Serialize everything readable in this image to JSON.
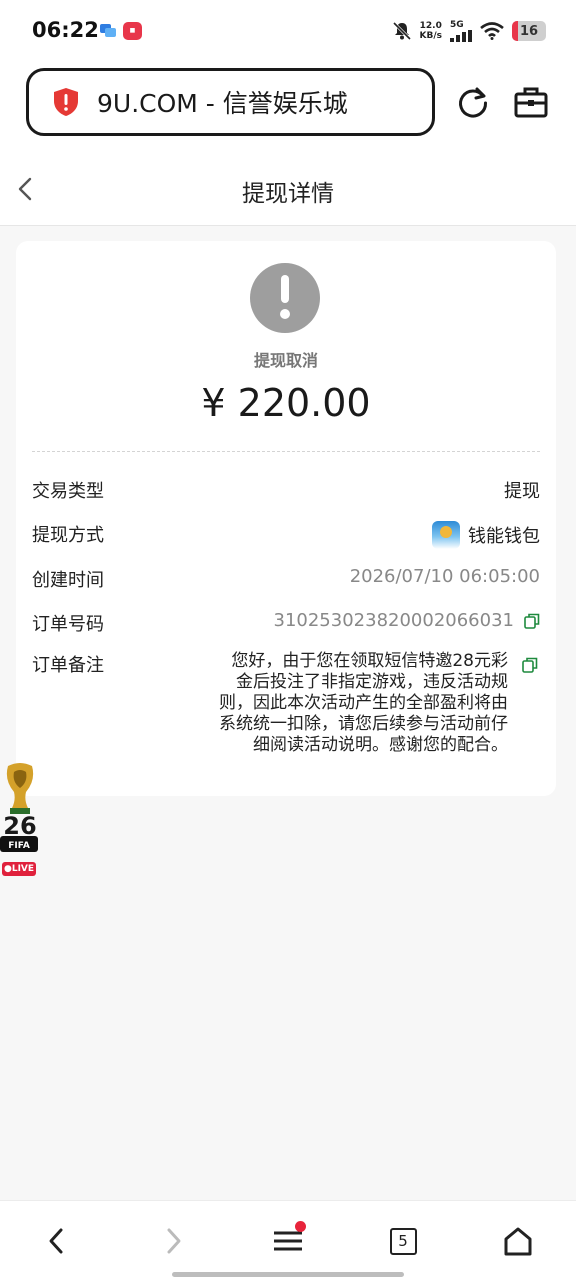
{
  "status_bar": {
    "time": "06:22",
    "speed_top": "12.0",
    "speed_unit": "KB/s",
    "network": "5G",
    "battery": "16"
  },
  "browser": {
    "url": "9U.COM - 信誉娱乐城"
  },
  "header": {
    "title": "提现详情"
  },
  "withdrawal": {
    "status": "提现取消",
    "amount": "¥ 220.00",
    "rows": [
      {
        "label": "交易类型",
        "value": "提现"
      },
      {
        "label": "提现方式",
        "value": "钱能钱包"
      },
      {
        "label": "创建时间",
        "value": "2026/07/10 06:05:00"
      },
      {
        "label": "订单号码",
        "value": "310253023820002066031"
      },
      {
        "label": "订单备注",
        "value": "您好，由于您在领取短信特邀28元彩金后投注了非指定游戏，违反活动规则，因此本次活动产生的全部盈利将由系统统一扣除，请您后续参与活动前仔细阅读活动说明。感谢您的配合。"
      }
    ]
  },
  "floating": {
    "fifa_label": "FIFA",
    "live_label": "LIVE"
  },
  "bottom_nav": {
    "tab_count": "5"
  }
}
